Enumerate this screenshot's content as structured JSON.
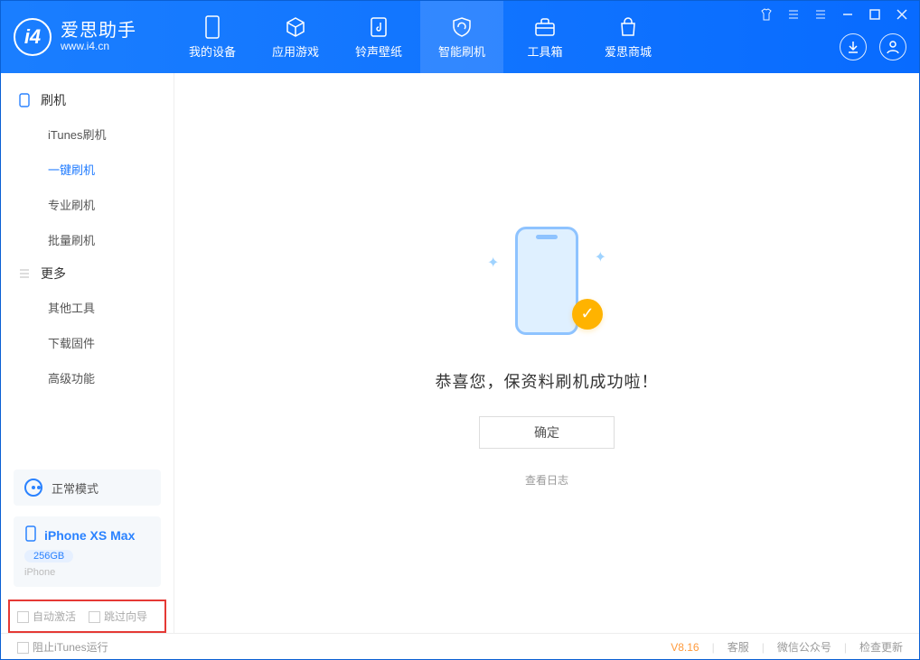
{
  "brand": {
    "name": "爱思助手",
    "url": "www.i4.cn"
  },
  "nav": {
    "tabs": [
      {
        "label": "我的设备"
      },
      {
        "label": "应用游戏"
      },
      {
        "label": "铃声壁纸"
      },
      {
        "label": "智能刷机"
      },
      {
        "label": "工具箱"
      },
      {
        "label": "爱思商城"
      }
    ]
  },
  "sidebar": {
    "flash_header": "刷机",
    "flash_items": [
      "iTunes刷机",
      "一键刷机",
      "专业刷机",
      "批量刷机"
    ],
    "more_header": "更多",
    "more_items": [
      "其他工具",
      "下载固件",
      "高级功能"
    ],
    "mode_label": "正常模式",
    "device": {
      "name": "iPhone XS Max",
      "capacity": "256GB",
      "sub": "iPhone"
    },
    "opts": {
      "auto_activate": "自动激活",
      "skip_guide": "跳过向导"
    }
  },
  "content": {
    "message": "恭喜您，保资料刷机成功啦！",
    "ok": "确定",
    "log_link": "查看日志"
  },
  "status": {
    "stop_itunes": "阻止iTunes运行",
    "version": "V8.16",
    "links": [
      "客服",
      "微信公众号",
      "检查更新"
    ]
  }
}
